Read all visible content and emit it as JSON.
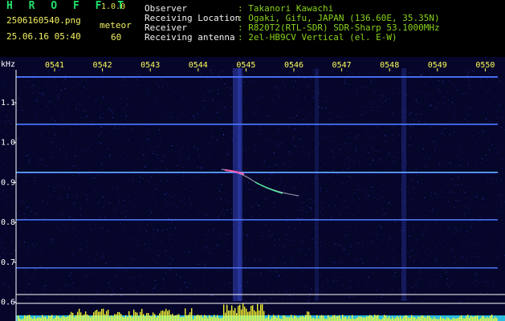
{
  "app": {
    "name": "H R O F F T",
    "version": "1.0.0"
  },
  "file": {
    "name": "2506160540.png",
    "datetime": "25.06.16 05:40"
  },
  "meteor": {
    "label": "meteor",
    "count": "60"
  },
  "info": [
    {
      "key": "Observer",
      "value": ": Takanori Kawachi"
    },
    {
      "key": "Receiving Location",
      "value": ": Ogaki, Gifu, JAPAN (136.60E, 35.35N)"
    },
    {
      "key": "Receiver",
      "value": ": R820T2(RTL-SDR) SDR-Sharp 53.1000MHz"
    },
    {
      "key": "Receiving antenna",
      "value": ": 2el-HB9CV Vertical (el. E-W)"
    }
  ],
  "spectrogram": {
    "unit_label": "kHz",
    "freq_ticks": [
      "1.1",
      "1.0",
      "0.9",
      "0.8",
      "0.7",
      "0.6"
    ],
    "time_ticks": [
      "0541",
      "0542",
      "0543",
      "0544",
      "0545",
      "0546",
      "0547",
      "0548",
      "0549",
      "0550"
    ],
    "colors": {
      "background": "#06052a",
      "trace": "#3a66ff",
      "echo": "#ff5ab0",
      "amplitude": "#ffff30",
      "baseline": "#33ddff"
    }
  }
}
